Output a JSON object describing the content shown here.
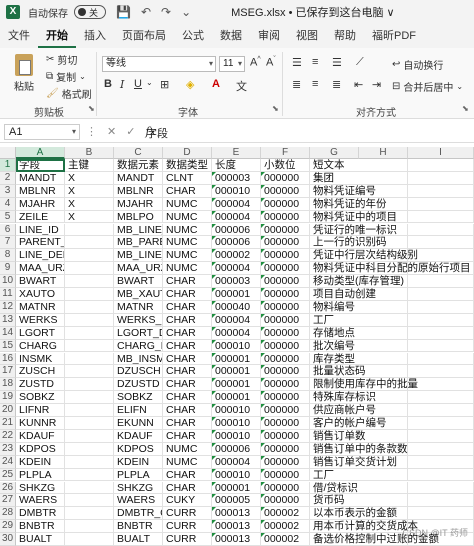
{
  "titlebar": {
    "autosave_label": "自动保存",
    "autosave_state": "关",
    "filename": "MSEG.xlsx • 已保存到这台电脑 ∨"
  },
  "menu": [
    "文件",
    "开始",
    "插入",
    "页面布局",
    "公式",
    "数据",
    "审阅",
    "视图",
    "帮助",
    "福昕PDF"
  ],
  "ribbon": {
    "paste": "粘贴",
    "cut": "剪切",
    "copy": "复制",
    "format_painter": "格式刷",
    "clipboard_group": "剪贴板",
    "font_name": "等线",
    "font_size": "11",
    "font_group": "字体",
    "wrap_text": "自动换行",
    "merge_center": "合并后居中",
    "align_group": "对齐方式"
  },
  "formula": {
    "namebox": "A1",
    "content": "字段"
  },
  "columns": [
    "A",
    "B",
    "C",
    "D",
    "E",
    "F",
    "G",
    "H",
    "I"
  ],
  "rows": [
    [
      "字段",
      "主键",
      "数据元素",
      "数据类型",
      "长度",
      "小数位",
      "短文本"
    ],
    [
      "MANDT",
      "X",
      "MANDT",
      "CLNT",
      "000003",
      "000000",
      "集团"
    ],
    [
      "MBLNR",
      "X",
      "MBLNR",
      "CHAR",
      "000010",
      "000000",
      "物料凭证编号"
    ],
    [
      "MJAHR",
      "X",
      "MJAHR",
      "NUMC",
      "000004",
      "000000",
      "物料凭证的年份"
    ],
    [
      "ZEILE",
      "X",
      "MBLPO",
      "NUMC",
      "000004",
      "000000",
      "物料凭证中的项目"
    ],
    [
      "LINE_ID",
      "",
      "MB_LINE_ID",
      "NUMC",
      "000006",
      "000000",
      "凭证行的唯一标识"
    ],
    [
      "PARENT_ID",
      "",
      "MB_PARENT_ID",
      "NUMC",
      "000006",
      "000000",
      "上一行的识别码"
    ],
    [
      "LINE_DEPTH",
      "",
      "MB_LINE_DEPTH",
      "NUMC",
      "000002",
      "000000",
      "凭证中行层次结构级别"
    ],
    [
      "MAA_URZEI",
      "",
      "MAA_URZEI",
      "NUMC",
      "000004",
      "000000",
      "物料凭证中科目分配的原始行项目"
    ],
    [
      "BWART",
      "",
      "BWART",
      "CHAR",
      "000003",
      "000000",
      "移动类型(库存管理)"
    ],
    [
      "XAUTO",
      "",
      "MB_XAUTO",
      "CHAR",
      "000001",
      "000000",
      "项目自动创建"
    ],
    [
      "MATNR",
      "",
      "MATNR",
      "CHAR",
      "000040",
      "000000",
      "物料编号"
    ],
    [
      "WERKS",
      "",
      "WERKS_D",
      "CHAR",
      "000004",
      "000000",
      "工厂"
    ],
    [
      "LGORT",
      "",
      "LGORT_D",
      "CHAR",
      "000004",
      "000000",
      "存储地点"
    ],
    [
      "CHARG",
      "",
      "CHARG_D",
      "CHAR",
      "000010",
      "000000",
      "批次编号"
    ],
    [
      "INSMK",
      "",
      "MB_INSMK",
      "CHAR",
      "000001",
      "000000",
      "库存类型"
    ],
    [
      "ZUSCH",
      "",
      "DZUSCH",
      "CHAR",
      "000001",
      "000000",
      "批量状态码"
    ],
    [
      "ZUSTD",
      "",
      "DZUSTD",
      "CHAR",
      "000001",
      "000000",
      "限制使用库存中的批量"
    ],
    [
      "SOBKZ",
      "",
      "SOBKZ",
      "CHAR",
      "000001",
      "000000",
      "特殊库存标识"
    ],
    [
      "LIFNR",
      "",
      "ELIFN",
      "CHAR",
      "000010",
      "000000",
      "供应商帐户号"
    ],
    [
      "KUNNR",
      "",
      "EKUNN",
      "CHAR",
      "000010",
      "000000",
      "客户的帐户编号"
    ],
    [
      "KDAUF",
      "",
      "KDAUF",
      "CHAR",
      "000010",
      "000000",
      "销售订单数"
    ],
    [
      "KDPOS",
      "",
      "KDPOS",
      "NUMC",
      "000006",
      "000000",
      "销售订单中的条款数"
    ],
    [
      "KDEIN",
      "",
      "KDEIN",
      "NUMC",
      "000004",
      "000000",
      "销售订单交货计划"
    ],
    [
      "PLPLA",
      "",
      "PLPLA",
      "CHAR",
      "000010",
      "000000",
      "工厂"
    ],
    [
      "SHKZG",
      "",
      "SHKZG",
      "CHAR",
      "000001",
      "000000",
      "借/贷标识"
    ],
    [
      "WAERS",
      "",
      "WAERS",
      "CUKY",
      "000005",
      "000000",
      "货币码"
    ],
    [
      "DMBTR",
      "",
      "DMBTR_CS",
      "CURR",
      "000013",
      "000002",
      "以本币表示的金额"
    ],
    [
      "BNBTR",
      "",
      "BNBTR",
      "CURR",
      "000013",
      "000002",
      "用本币计算的交货成本"
    ],
    [
      "BUALT",
      "",
      "BUALT",
      "CURR",
      "000013",
      "000002",
      "备选价格控制中过账的金额"
    ]
  ],
  "watermark": "CSDN @IT 药师",
  "colors": {
    "accent": "#1e7145"
  }
}
